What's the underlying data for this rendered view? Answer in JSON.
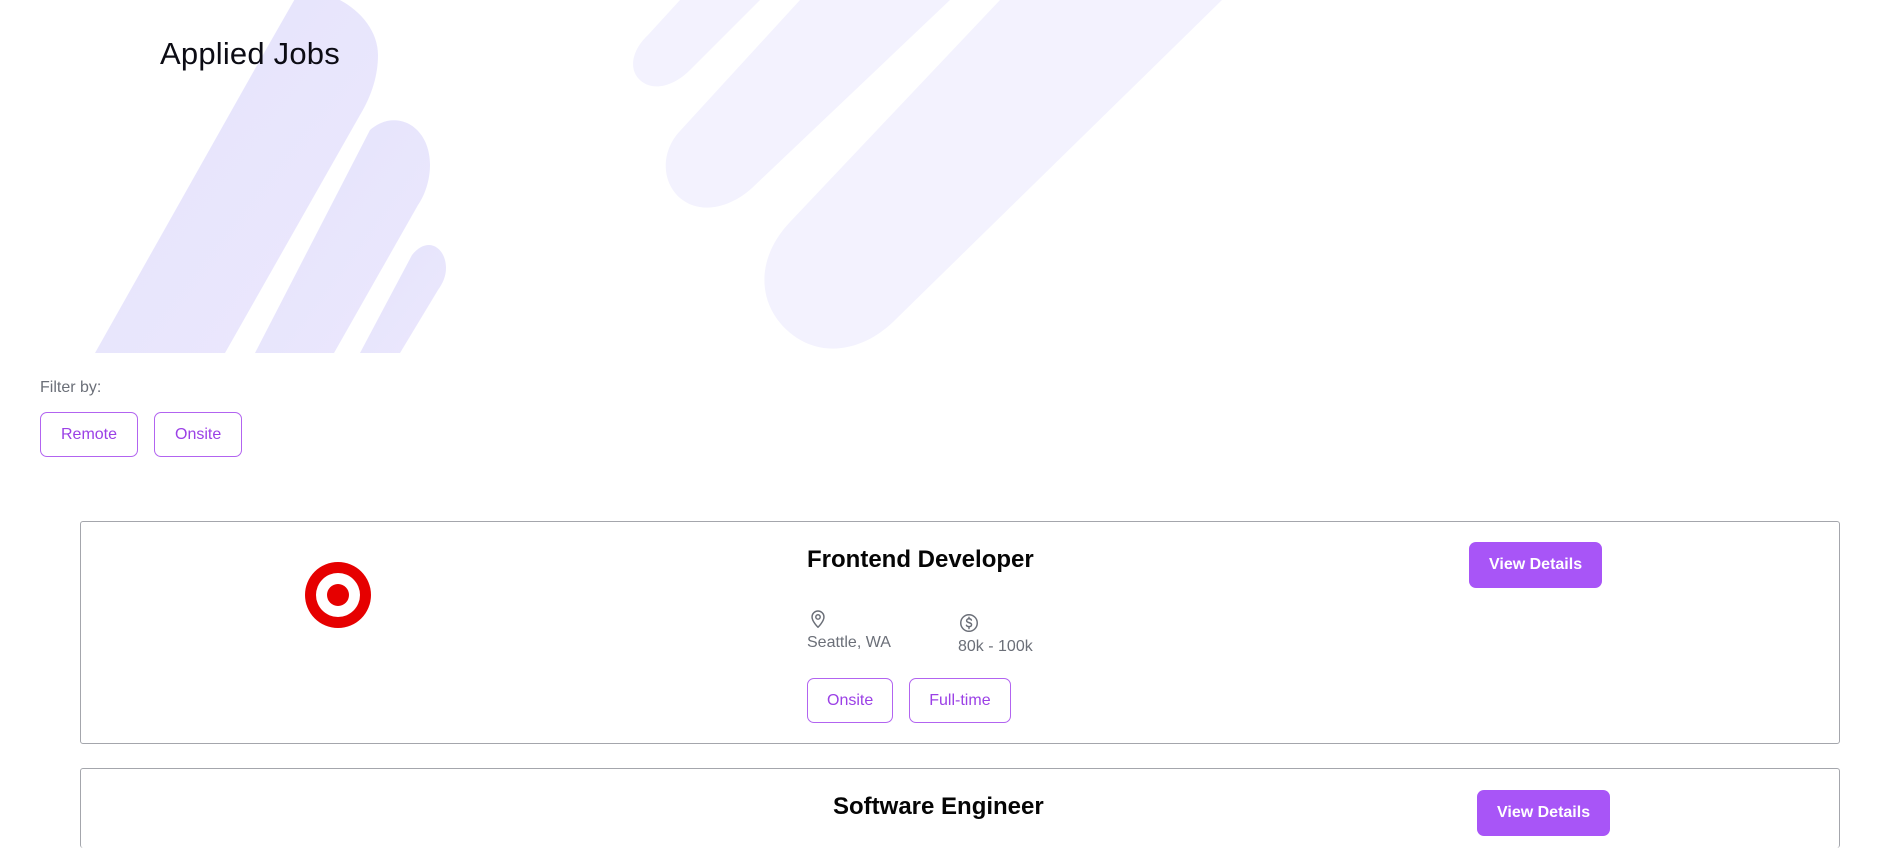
{
  "page": {
    "title": "Applied Jobs"
  },
  "filters": {
    "label": "Filter by:",
    "options": [
      "Remote",
      "Onsite"
    ]
  },
  "jobs": [
    {
      "title": "Frontend Developer",
      "company_logo": "bullseye-logo",
      "location": "Seattle, WA",
      "salary": "80k - 100k",
      "tags": [
        "Onsite",
        "Full-time"
      ],
      "action_label": "View Details"
    },
    {
      "title": "Software Engineer",
      "action_label": "View Details"
    }
  ],
  "icons": {
    "location": "map-pin-icon",
    "salary": "dollar-circle-icon"
  },
  "colors": {
    "accent": "#a855f7",
    "accent_text": "#9b40e6",
    "hero_shape": "#e8e6fd",
    "logo_red": "#e60000",
    "muted_text": "#6b6f78"
  }
}
